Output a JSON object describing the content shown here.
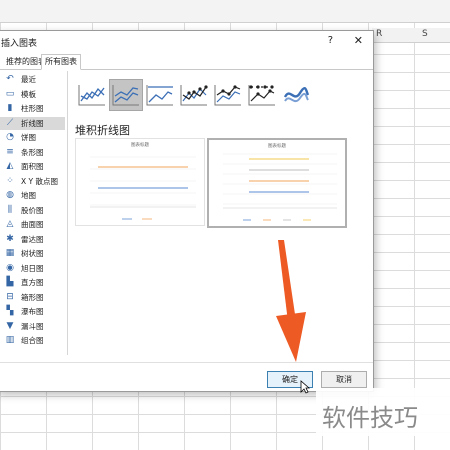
{
  "dialog": {
    "title": "插入图表",
    "help": "?",
    "close": "✕",
    "tabs": [
      {
        "label": "推荐的图表",
        "active": false
      },
      {
        "label": "所有图表",
        "active": true
      }
    ],
    "chart_types": [
      {
        "label": "最近",
        "icon": "undo-icon"
      },
      {
        "label": "模板",
        "icon": "folder-icon"
      },
      {
        "label": "柱形图",
        "icon": "column-chart-icon"
      },
      {
        "label": "折线图",
        "icon": "line-chart-icon",
        "selected": true
      },
      {
        "label": "饼图",
        "icon": "pie-chart-icon"
      },
      {
        "label": "条形图",
        "icon": "bar-chart-icon"
      },
      {
        "label": "面积图",
        "icon": "area-chart-icon"
      },
      {
        "label": "X Y 散点图",
        "icon": "scatter-chart-icon"
      },
      {
        "label": "地图",
        "icon": "map-chart-icon"
      },
      {
        "label": "股价图",
        "icon": "stock-chart-icon"
      },
      {
        "label": "曲面图",
        "icon": "surface-chart-icon"
      },
      {
        "label": "雷达图",
        "icon": "radar-chart-icon"
      },
      {
        "label": "树状图",
        "icon": "treemap-chart-icon"
      },
      {
        "label": "旭日图",
        "icon": "sunburst-chart-icon"
      },
      {
        "label": "直方图",
        "icon": "histogram-chart-icon"
      },
      {
        "label": "箱形图",
        "icon": "box-chart-icon"
      },
      {
        "label": "瀑布图",
        "icon": "waterfall-chart-icon"
      },
      {
        "label": "漏斗图",
        "icon": "funnel-chart-icon"
      },
      {
        "label": "组合图",
        "icon": "combo-chart-icon"
      }
    ],
    "subtype_title": "堆积折线图",
    "preview_chart_title": "图表标题",
    "ok_label": "确定",
    "cancel_label": "取消"
  },
  "sheet": {
    "column_headers": [
      "R",
      "S"
    ]
  },
  "watermark": "软件技巧",
  "colors": {
    "accent_blue": "#3465a4",
    "arrow_orange": "#ee5a24",
    "series_orange": "#f2a65a",
    "series_blue": "#5b8bd0"
  }
}
